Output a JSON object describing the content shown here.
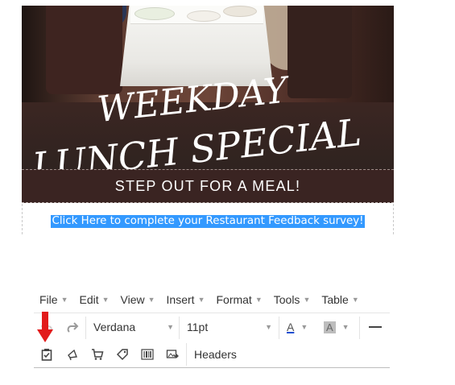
{
  "banner": {
    "headline_line1": "WEEKDAY",
    "headline_line2": "LUNCH SPECIAL",
    "subheadline": "STEP OUT FOR A MEAL!",
    "survey_link": "Click Here to complete your Restaurant Feedback survey!"
  },
  "menubar": {
    "items": [
      {
        "label": "File"
      },
      {
        "label": "Edit"
      },
      {
        "label": "View"
      },
      {
        "label": "Insert"
      },
      {
        "label": "Format"
      },
      {
        "label": "Tools"
      },
      {
        "label": "Table"
      }
    ]
  },
  "toolbar": {
    "font_family": "Verdana",
    "font_size": "11pt",
    "text_color_glyph": "A",
    "bg_color_glyph": "A",
    "headers_label": "Headers",
    "text_color_swatch": "#1f4fd1",
    "bg_color_swatch": "#8a8a8a"
  },
  "icons": [
    "undo-icon",
    "redo-icon",
    "survey-clipboard-icon",
    "megaphone-icon",
    "cart-icon",
    "tag-icon",
    "barcode-icon",
    "image-export-icon"
  ],
  "colors": {
    "selection": "#3399ff",
    "banner_brown": "#3a2422",
    "annotation_arrow": "#e21b1b"
  }
}
